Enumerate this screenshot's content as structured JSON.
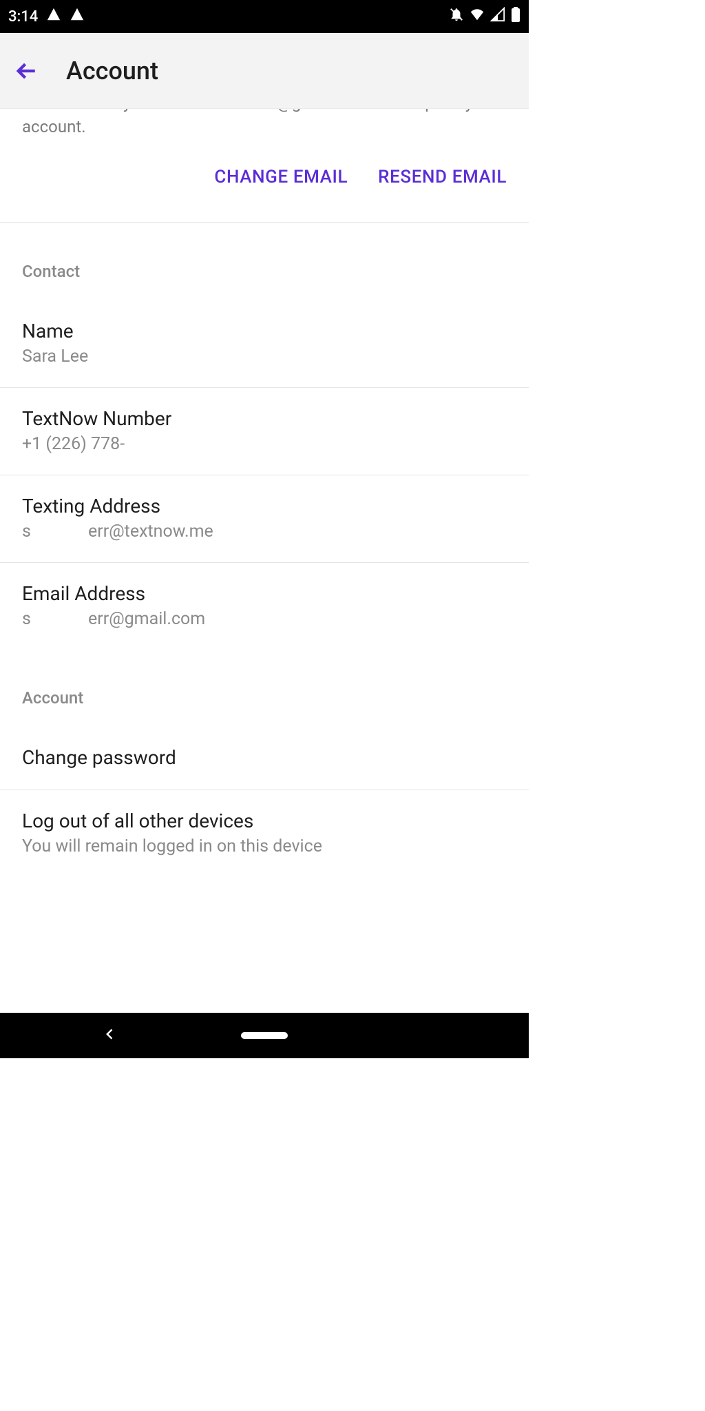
{
  "status": {
    "time": "3:14"
  },
  "appbar": {
    "title": "Account"
  },
  "verify": {
    "message": "Please check your email santamen@gmail.com to complete your account.",
    "change_email": "CHANGE EMAIL",
    "resend_email": "RESEND EMAIL"
  },
  "sections": {
    "contact": {
      "header": "Contact",
      "name_label": "Name",
      "name_value": "Sara Lee",
      "number_label": "TextNow Number",
      "number_value": "+1 (226) 778-",
      "texting_address_label": "Texting Address",
      "texting_address_left": "s",
      "texting_address_right": "err@textnow.me",
      "email_label": "Email Address",
      "email_left": "s",
      "email_right": "err@gmail.com"
    },
    "account": {
      "header": "Account",
      "change_password": "Change password",
      "logout_title": "Log out of all other devices",
      "logout_sub": "You will remain logged in on this device"
    }
  }
}
